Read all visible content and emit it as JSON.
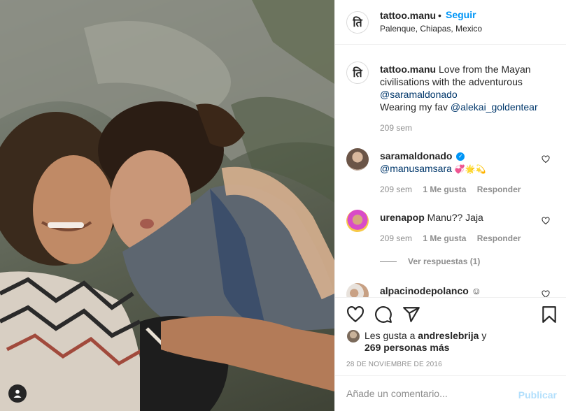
{
  "header": {
    "username": "tattoo.manu",
    "separator": "•",
    "follow_label": "Seguir",
    "location": "Palenque, Chiapas, Mexico",
    "logo_glyph": "ति"
  },
  "caption": {
    "username": "tattoo.manu",
    "text_1": "Love from the Mayan civilisations with the adventurous",
    "mention_1": "@saramaldonado",
    "text_2": "Wearing my fav",
    "mention_2": "@alekai_goldentear",
    "time": "209 sem"
  },
  "comments": [
    {
      "username": "saramaldonado",
      "verified": true,
      "mention": "@manusamsara",
      "emojis": "💞🌟💫",
      "time": "209 sem",
      "likes": "1 Me gusta",
      "reply_label": "Responder"
    },
    {
      "username": "urenapop",
      "text": "Manu?? Jaja",
      "time": "209 sem",
      "likes": "1 Me gusta",
      "reply_label": "Responder",
      "view_replies": "Ver respuestas (1)"
    },
    {
      "username": "alpacinodepolanco",
      "text": "☺"
    }
  ],
  "likes": {
    "prefix": "Les gusta a",
    "first_user": "andreslebrija",
    "conj": "y",
    "others": "269 personas más"
  },
  "date": "28 DE NOVIEMBRE DE 2016",
  "comment_box": {
    "placeholder": "Añade un comentario...",
    "publish_label": "Publicar"
  },
  "colors": {
    "accent": "#0095f6",
    "publish_disabled": "#b2dffc",
    "muted": "#8e8e8e",
    "text": "#262626"
  },
  "icons": [
    "heart-icon",
    "comment-icon",
    "share-icon",
    "bookmark-icon",
    "user-tag-icon",
    "verified-icon"
  ]
}
